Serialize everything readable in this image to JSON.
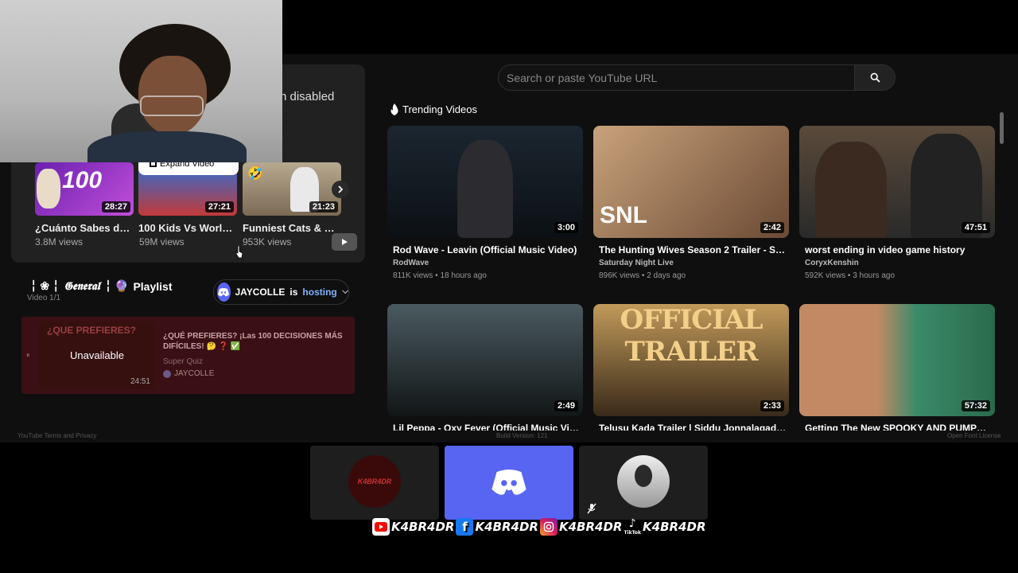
{
  "search": {
    "placeholder": "Search or paste YouTube URL"
  },
  "left": {
    "disabled_text": "n disabled",
    "expand_label": "Expand Video",
    "recommended": [
      {
        "title": "¿Cuánto Sabes de ...",
        "views": "3.8M views",
        "duration": "28:27",
        "thumb_text": "100"
      },
      {
        "title": "100 Kids Vs World'...",
        "views": "59M views",
        "duration": "27:21"
      },
      {
        "title": "Funniest Cats & Do...",
        "views": "953K views",
        "duration": "21:23"
      }
    ]
  },
  "playlist": {
    "prefix": "╎ ❀ ╎",
    "name": "𝕲𝖊𝖓𝖊𝖗𝖆𝖑",
    "divider": "╎ 🔮",
    "label": "Playlist",
    "count": "Video 1/1",
    "host_name": "JAYCOLLE",
    "host_is": "is",
    "host_status": "hosting",
    "item": {
      "thumb_text": "¿QUE PREFIERES?",
      "status": "Unavailable",
      "duration": "24:51",
      "title": "¿QUÉ PREFIERES? ¡Las 100 DECISIONES MÁS DIFÍCILES! 🤔 ❓ ✅",
      "channel": "Super Quiz",
      "added_by": "JAYCOLLE"
    }
  },
  "trending": {
    "header": "Trending Videos",
    "videos": [
      {
        "title": "Rod Wave - Leavin (Official Music Video)",
        "channel": "RodWave",
        "meta": "811K views • 18 hours ago",
        "duration": "3:00"
      },
      {
        "title": "The Hunting Wives Season 2 Trailer - SNL",
        "channel": "Saturday Night Live",
        "meta": "896K views • 2 days ago",
        "duration": "2:42",
        "overlay": "SNL"
      },
      {
        "title": "worst ending in video game history",
        "channel": "CoryxKenshin",
        "meta": "592K views • 3 hours ago",
        "duration": "47:51"
      },
      {
        "title": "Lil Peppa - Oxy Fever (Official Music Video)",
        "duration": "2:49"
      },
      {
        "title": "Telusu Kada Trailer | Siddu Jonnalagadda |",
        "duration": "2:33",
        "overlay": "OFFICIAL TRAILER"
      },
      {
        "title": "Getting The New SPOOKY AND PUMPKY in",
        "duration": "57:32"
      }
    ]
  },
  "footer": {
    "left": "YouTube Terms and Privacy",
    "center": "Build Version: 121",
    "right": "Open Font License"
  },
  "overlay": {
    "tile_left_text": "K4BR4DR",
    "handles": [
      "K4BR4DR",
      "K4BR4DR",
      "K4BR4DR",
      "K4BR4DR"
    ],
    "tiktok_label": "TikTok"
  },
  "colors": {
    "accent": "#5865f2",
    "hosting": "#7fb2ff",
    "playlist_bg": "#3a1014"
  }
}
